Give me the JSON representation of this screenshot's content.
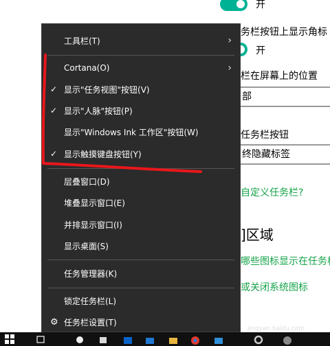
{
  "background": {
    "toggle1_label": "开",
    "badge_heading": "务栏按钮上显示角标",
    "toggle2_label": "开",
    "position_heading": "栏在屏幕上的位置",
    "position_value": "部",
    "combine_heading": "任务栏按钮",
    "combine_value": "终隐藏标签",
    "customize_link": "自定义任务栏?",
    "notify_heading": "]区域",
    "notify_link1": "哪些图标显示在任务栏",
    "notify_link2": "或关闭系统图标"
  },
  "menu": {
    "toolbars": "工具栏(T)",
    "cortana": "Cortana(O)",
    "task_view": "显示\"任务视图\"按钮(V)",
    "people": "显示\"人脉\"按钮(P)",
    "ink": "显示\"Windows Ink 工作区\"按钮(W)",
    "touch_keyboard": "显示触摸键盘按钮(Y)",
    "cascade": "层叠窗口(D)",
    "stacked": "堆叠显示窗口(E)",
    "side_by_side": "并排显示窗口(I)",
    "show_desktop": "显示桌面(S)",
    "task_manager": "任务管理器(K)",
    "lock_taskbar": "锁定任务栏(L)",
    "taskbar_settings": "任务栏设置(T)",
    "check_glyph": "✓",
    "arrow_glyph": "›",
    "gear_glyph": "⚙"
  },
  "watermark": {
    "brand": "Bai",
    "brand2": "经验",
    "url": "jingyan.baidu.com"
  },
  "colors": {
    "menu_bg": "#2b2b2b",
    "accent_green": "#00b294",
    "link_green": "#16a34a",
    "annotation_red": "#e8171b"
  }
}
